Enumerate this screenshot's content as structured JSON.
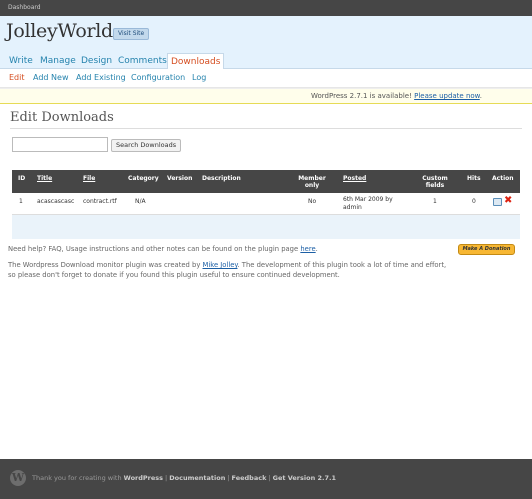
{
  "topbar": {
    "label": "Dashboard"
  },
  "site": {
    "title": "JolleyWorld",
    "visit_site": "Visit Site"
  },
  "menu": {
    "items": [
      {
        "label": "Write"
      },
      {
        "label": "Manage"
      },
      {
        "label": "Design"
      },
      {
        "label": "Comments"
      },
      {
        "label": "Downloads"
      }
    ]
  },
  "submenu": {
    "items": [
      {
        "label": "Edit"
      },
      {
        "label": "Add New"
      },
      {
        "label": "Add Existing"
      },
      {
        "label": "Configuration"
      },
      {
        "label": "Log"
      }
    ]
  },
  "update_nag": {
    "text": "WordPress 2.7.1 is available! ",
    "link": "Please update now",
    "suffix": "."
  },
  "page": {
    "heading": "Edit Downloads"
  },
  "search": {
    "value": "",
    "button": "Search Downloads"
  },
  "table": {
    "headers": {
      "id": "ID",
      "title": "Title",
      "file": "File",
      "category": "Category",
      "version": "Version",
      "description": "Description",
      "member_only": "Member only",
      "posted": "Posted",
      "custom_fields": "Custom fields",
      "hits": "Hits",
      "action": "Action"
    },
    "rows": [
      {
        "id": "1",
        "title": "acascascasc",
        "file": "contract.rtf",
        "category": "N/A",
        "version": "",
        "description": "",
        "member_only": "No",
        "posted": "6th Mar 2009 by admin",
        "custom_fields": "1",
        "hits": "0"
      }
    ]
  },
  "help": {
    "text": "Need help? FAQ, Usage instructions and other notes can be found on the plugin page ",
    "link": "here",
    "suffix": "."
  },
  "donate": {
    "label": "Make A Donation"
  },
  "credit": {
    "before": "The Wordpress Download monitor plugin was created by ",
    "author": "Mike Jolley",
    "after": ". The development of this plugin took a lot of time and effort, so please don't forget to donate if you found this plugin useful to ensure continued development."
  },
  "footer": {
    "thanks": "Thank you for creating with ",
    "wordpress": "WordPress",
    "documentation": "Documentation",
    "feedback": "Feedback",
    "version": "Get Version 2.7.1"
  },
  "icons": {
    "edit": "edit-icon",
    "delete": "delete-icon",
    "logo": "wordpress-logo-icon"
  },
  "colors": {
    "accent": "#d54e21",
    "link": "#2583ad",
    "header_bg": "#464646",
    "menu_bg": "#e4f2fd",
    "donate": "#f7b733"
  }
}
